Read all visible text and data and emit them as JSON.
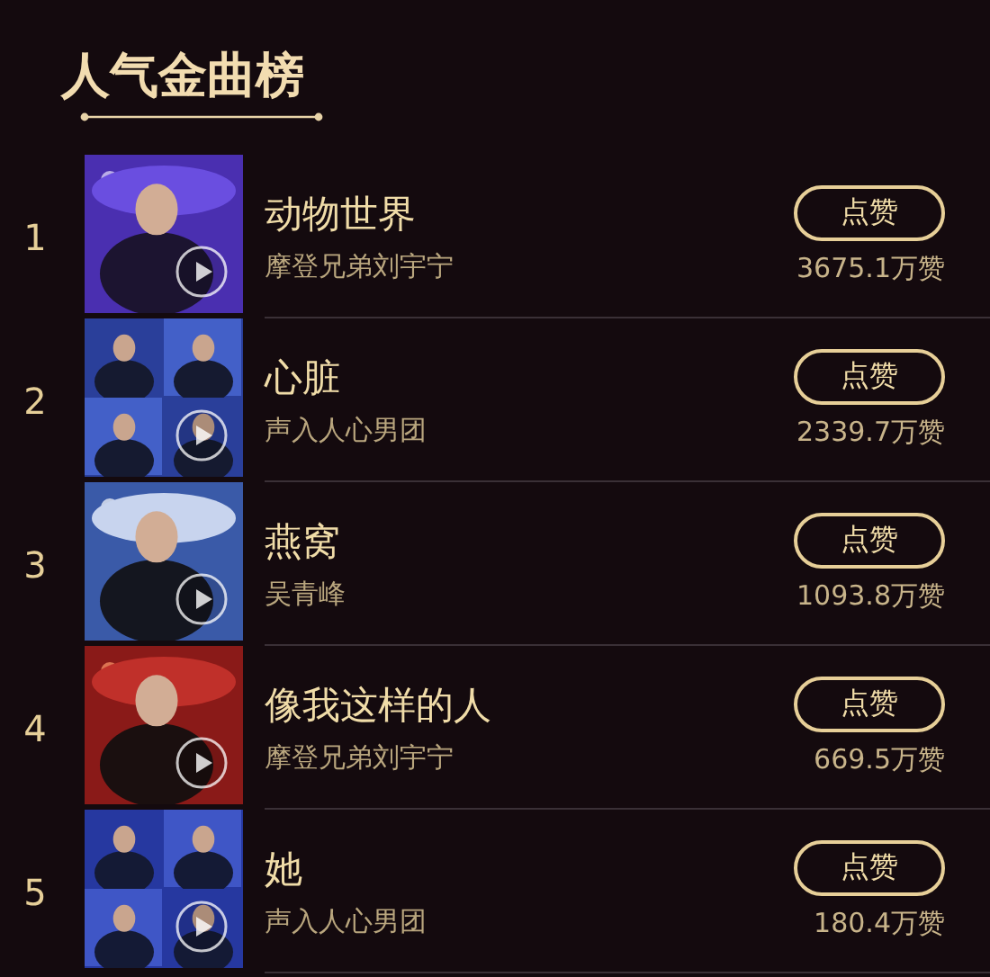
{
  "header": {
    "title": "人气金曲榜"
  },
  "songs": [
    {
      "rank": "1",
      "title": "动物世界",
      "artist": "摩登兄弟刘宇宁",
      "button": "点赞",
      "likes": "3675.1万赞"
    },
    {
      "rank": "2",
      "title": "心脏",
      "artist": "声入人心男团",
      "button": "点赞",
      "likes": "2339.7万赞"
    },
    {
      "rank": "3",
      "title": "燕窝",
      "artist": "吴青峰",
      "button": "点赞",
      "likes": "1093.8万赞"
    },
    {
      "rank": "4",
      "title": "像我这样的人",
      "artist": "摩登兄弟刘宇宁",
      "button": "点赞",
      "likes": "669.5万赞"
    },
    {
      "rank": "5",
      "title": "她",
      "artist": "声入人心男团",
      "button": "点赞",
      "likes": "180.4万赞"
    }
  ]
}
